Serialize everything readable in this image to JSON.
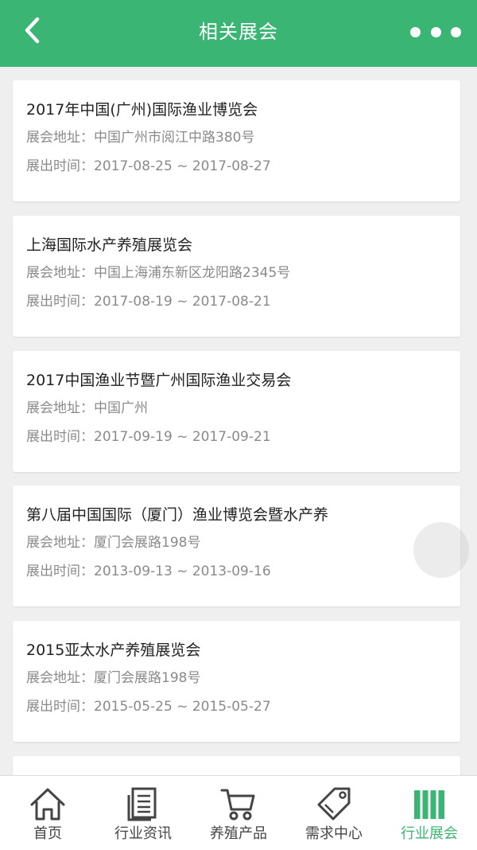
{
  "header": {
    "title": "相关展会"
  },
  "cards": [
    {
      "title": "2017年中国(广州)国际渔业博览会",
      "address": "展会地址：中国广州市阅江中路380号",
      "time": "展出时间：2017-08-25 ~ 2017-08-27"
    },
    {
      "title": "上海国际水产养殖展览会",
      "address": "展会地址：中国上海浦东新区龙阳路2345号",
      "time": "展出时间：2017-08-19 ~ 2017-08-21"
    },
    {
      "title": "2017中国渔业节暨广州国际渔业交易会",
      "address": "展会地址：中国广州",
      "time": "展出时间：2017-09-19 ~ 2017-09-21"
    },
    {
      "title": "第八届中国国际（厦门）渔业博览会暨水产养",
      "address": "展会地址：厦门会展路198号",
      "time": "展出时间：2013-09-13 ~ 2013-09-16"
    },
    {
      "title": "2015亚太水产养殖展览会",
      "address": "展会地址：厦门会展路198号",
      "time": "展出时间：2015-05-25 ~ 2015-05-27"
    }
  ],
  "tabbar": {
    "items": [
      {
        "label": "首页",
        "icon": "home-icon"
      },
      {
        "label": "行业资讯",
        "icon": "news-icon"
      },
      {
        "label": "养殖产品",
        "icon": "cart-icon"
      },
      {
        "label": "需求中心",
        "icon": "tag-icon"
      },
      {
        "label": "行业展会",
        "icon": "exhibition-icon",
        "active": true
      }
    ]
  },
  "colors": {
    "brand": "#3bb573",
    "title_text": "#222222",
    "meta_text": "#8a8a8a",
    "tab_text": "#444444"
  }
}
